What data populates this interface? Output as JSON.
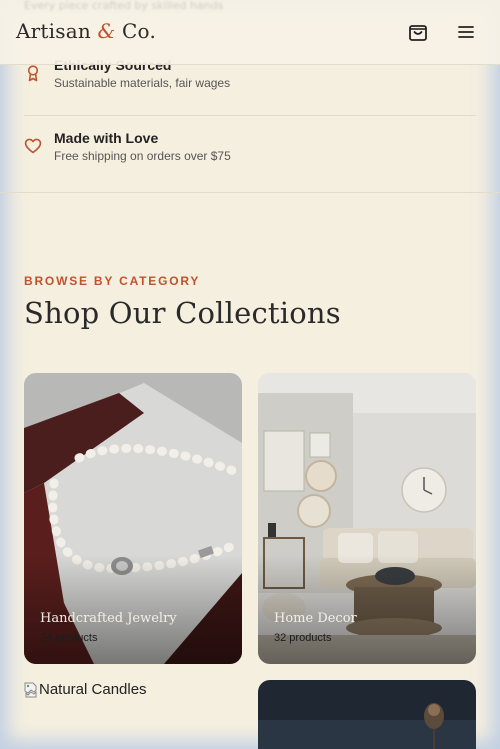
{
  "header": {
    "brand_name": "Artisan",
    "brand_amp": "&",
    "brand_suffix": "Co.",
    "ghost_text": "Every piece crafted by skilled hands",
    "cart_icon": "shopping-bag-icon",
    "menu_icon": "hamburger-menu-icon"
  },
  "features": [
    {
      "title": "Ethically Sourced",
      "subtitle": "Sustainable materials, fair wages",
      "icon": "ribbon-award-icon"
    },
    {
      "title": "Made with Love",
      "subtitle": "Free shipping on orders over $75",
      "icon": "heart-icon"
    }
  ],
  "section": {
    "eyebrow": "BROWSE BY CATEGORY",
    "title": "Shop Our Collections"
  },
  "collections": [
    {
      "name": "Handcrafted Jewelry",
      "count": "24 products"
    },
    {
      "name": "Home Decor",
      "count": "32 products"
    },
    {
      "name": "Natural Candles"
    },
    {
      "name": ""
    }
  ],
  "colors": {
    "accent": "#c0532e",
    "background": "#f5efe0",
    "text": "#2a2a2a"
  }
}
